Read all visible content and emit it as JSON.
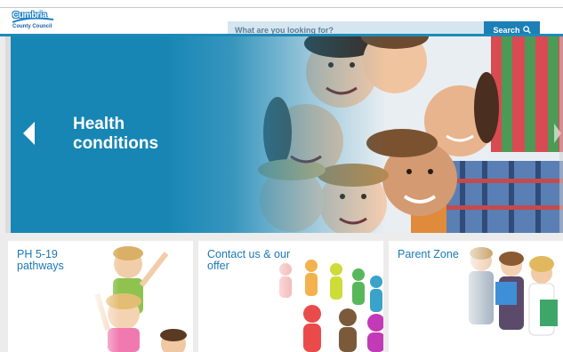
{
  "header": {
    "logo_word": "Cumbria",
    "logo_sub": "County Council",
    "search_placeholder": "What are you looking for?",
    "search_button": "Search"
  },
  "hero": {
    "title_line1": "Health",
    "title_line2": "conditions"
  },
  "tiles": [
    {
      "title_line1": "PH 5-19",
      "title_line2": "pathways"
    },
    {
      "title_line1": "Contact us & our",
      "title_line2": "offer"
    },
    {
      "title_line1": "Parent Zone",
      "title_line2": ""
    }
  ],
  "colors": {
    "brand_blue": "#1c7fb5",
    "hero_blue": "#1786b4",
    "tile_text": "#1a79b5",
    "search_bg": "#d6e6f0"
  },
  "icons": {
    "search_button_icon": "search-icon",
    "hero_prev": "chevron-left-icon",
    "hero_next": "chevron-right-icon"
  }
}
